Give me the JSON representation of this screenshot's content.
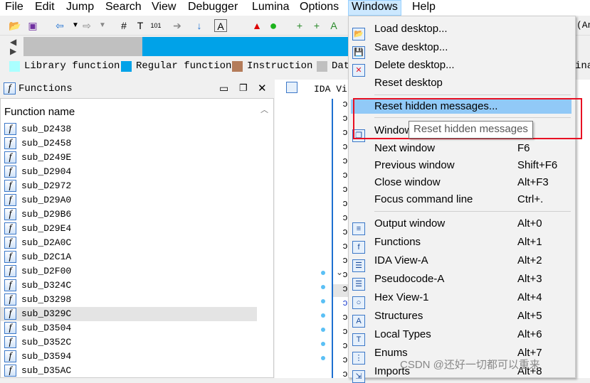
{
  "menubar": [
    "File",
    "Edit",
    "Jump",
    "Search",
    "View",
    "Debugger",
    "Lumina",
    "Options",
    "Windows",
    "Help"
  ],
  "legend": [
    {
      "label": "Library function",
      "color": "#aaffff"
    },
    {
      "label": "Regular function",
      "color": "#00a2e8"
    },
    {
      "label": "Instruction",
      "color": "#b47c5a"
    },
    {
      "label": "Dat",
      "color": "#c0c0c0"
    }
  ],
  "toolbar_right_text": "(And",
  "right_label": "ina",
  "functions_panel": {
    "title": "Functions",
    "column": "Function name",
    "items": [
      "sub_D2438",
      "sub_D2458",
      "sub_D249E",
      "sub_D2904",
      "sub_D2972",
      "sub_D29A0",
      "sub_D29B6",
      "sub_D29E4",
      "sub_D2A0C",
      "sub_D2C1A",
      "sub_D2F00",
      "sub_D324C",
      "sub_D3298",
      "sub_D329C",
      "sub_D3504",
      "sub_D352C",
      "sub_D3594",
      "sub_D35AC"
    ],
    "selected": "sub_D329C"
  },
  "ida_tab": "IDA Vi",
  "windows_menu": {
    "items": [
      {
        "label": "Load desktop...",
        "shortcut": "",
        "icon": "load-desktop-icon"
      },
      {
        "label": "Save desktop...",
        "shortcut": "",
        "icon": "save-desktop-icon"
      },
      {
        "label": "Delete desktop...",
        "shortcut": "",
        "icon": "delete-desktop-icon"
      },
      {
        "label": "Reset desktop",
        "shortcut": "",
        "icon": ""
      },
      {
        "label": "Reset hidden messages...",
        "shortcut": "",
        "icon": "",
        "highlighted": true
      },
      {
        "label": "Windows list",
        "shortcut": "",
        "icon": "windows-list-icon"
      },
      {
        "label": "Next window",
        "shortcut": "F6",
        "icon": ""
      },
      {
        "label": "Previous window",
        "shortcut": "Shift+F6",
        "icon": ""
      },
      {
        "label": "Close window",
        "shortcut": "Alt+F3",
        "icon": ""
      },
      {
        "label": "Focus command line",
        "shortcut": "Ctrl+.",
        "icon": ""
      },
      {
        "label": "Output window",
        "shortcut": "Alt+0",
        "icon": "output-window-icon"
      },
      {
        "label": "Functions",
        "shortcut": "Alt+1",
        "icon": "functions-icon"
      },
      {
        "label": "IDA View-A",
        "shortcut": "Alt+2",
        "icon": "ida-view-icon"
      },
      {
        "label": "Pseudocode-A",
        "shortcut": "Alt+3",
        "icon": "pseudocode-icon"
      },
      {
        "label": "Hex View-1",
        "shortcut": "Alt+4",
        "icon": "hex-view-icon"
      },
      {
        "label": "Structures",
        "shortcut": "Alt+5",
        "icon": "structures-icon"
      },
      {
        "label": "Local Types",
        "shortcut": "Alt+6",
        "icon": "local-types-icon"
      },
      {
        "label": "Enums",
        "shortcut": "Alt+7",
        "icon": "enums-icon"
      },
      {
        "label": "Imports",
        "shortcut": "Alt+8",
        "icon": "imports-icon"
      }
    ],
    "tooltip": "Reset hidden messages"
  },
  "watermark": "CSDN @还好一切都可以重来",
  "colors": {
    "highlight": "#91c9f7",
    "annotation": "#e81123",
    "regular": "#00a2e8"
  }
}
